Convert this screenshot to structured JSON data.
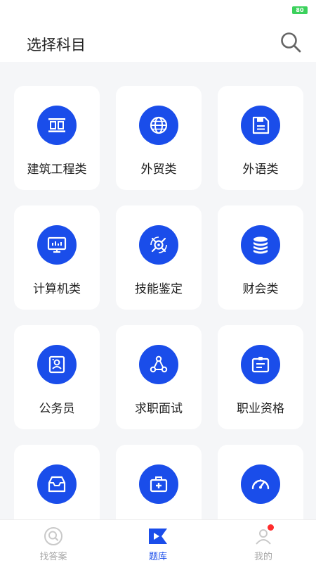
{
  "status_bar": {
    "battery": "80"
  },
  "header": {
    "title": "选择科目"
  },
  "categories": [
    {
      "label": "建筑工程类",
      "icon": "building-icon"
    },
    {
      "label": "外贸类",
      "icon": "globe-icon"
    },
    {
      "label": "外语类",
      "icon": "floppy-disk-icon"
    },
    {
      "label": "计算机类",
      "icon": "monitor-icon"
    },
    {
      "label": "技能鉴定",
      "icon": "skill-check-icon"
    },
    {
      "label": "财会类",
      "icon": "coin-stack-icon"
    },
    {
      "label": "公务员",
      "icon": "id-card-icon"
    },
    {
      "label": "求职面试",
      "icon": "network-icon"
    },
    {
      "label": "职业资格",
      "icon": "certificate-icon"
    },
    {
      "label": "",
      "icon": "inbox-icon"
    },
    {
      "label": "",
      "icon": "medical-kit-icon"
    },
    {
      "label": "",
      "icon": "speedometer-icon"
    }
  ],
  "tabbar": {
    "tabs": [
      {
        "label": "找答案",
        "icon": "search-icon",
        "active": false
      },
      {
        "label": "题库",
        "icon": "play-flag-icon",
        "active": true
      },
      {
        "label": "我的",
        "icon": "profile-icon",
        "active": false
      }
    ]
  },
  "colors": {
    "accent": "#1a4dea",
    "badge": "#ff2d2d",
    "battery": "#3bd15c"
  }
}
